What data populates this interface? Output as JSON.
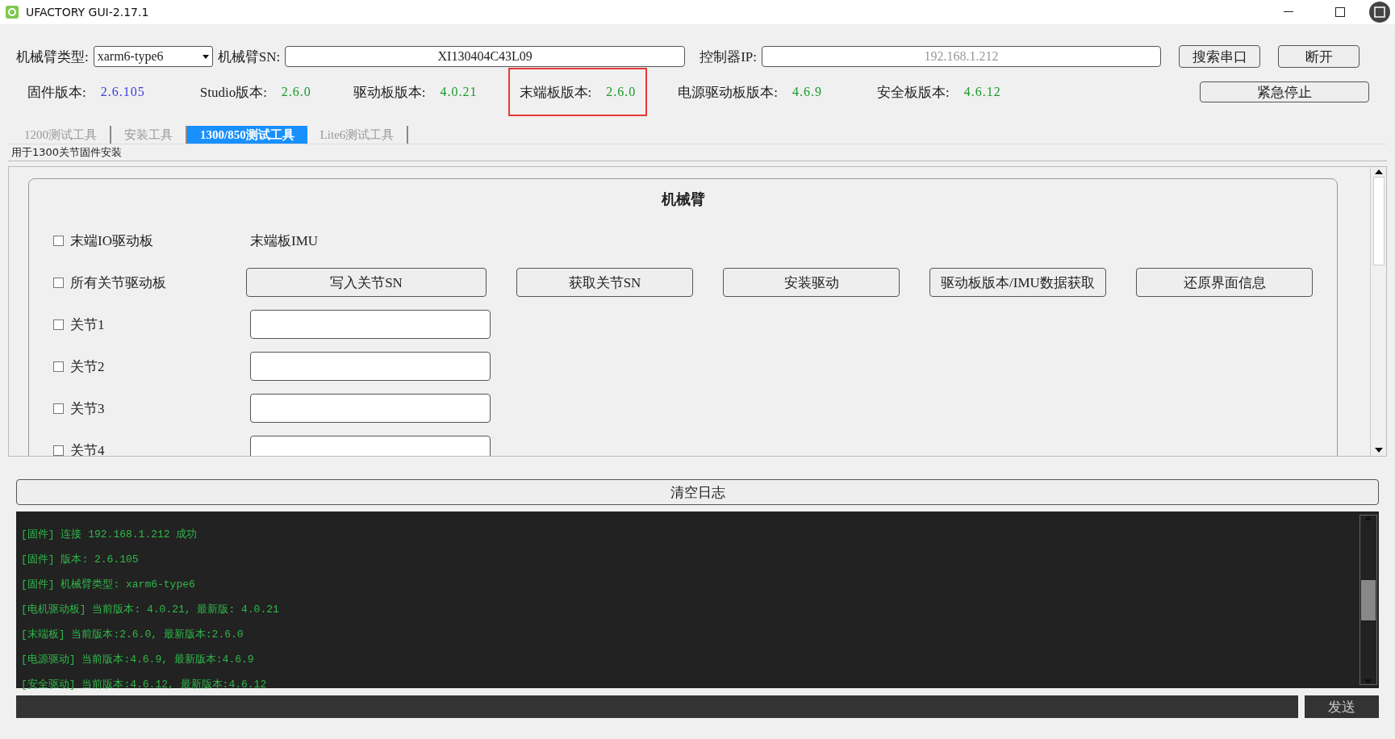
{
  "window": {
    "title": "UFACTORY GUI-2.17.1"
  },
  "connection": {
    "arm_type_label": "机械臂类型:",
    "arm_type": "xarm6-type6",
    "sn_label": "机械臂SN:",
    "sn": "XI130404C43L09",
    "ip_label": "控制器IP:",
    "ip": "192.168.1.212",
    "buttons": [
      "搜索串口",
      "断开"
    ]
  },
  "versions": [
    {
      "label": "固件版本:",
      "value": "2.6.105",
      "color": "#3a3ae0",
      "highlighted": false
    },
    {
      "label": "Studio版本:",
      "value": "2.6.0",
      "color": "#1a9a2a",
      "highlighted": false
    },
    {
      "label": "驱动板版本:",
      "value": "4.0.21",
      "color": "#1a9a2a",
      "highlighted": false
    },
    {
      "label": "末端板版本:",
      "value": "2.6.0",
      "color": "#1a9a2a",
      "highlighted": true
    },
    {
      "label": "电源驱动板版本:",
      "value": "4.6.9",
      "color": "#1a9a2a",
      "highlighted": false
    },
    {
      "label": "安全板版本:",
      "value": "4.6.12",
      "color": "#1a9a2a",
      "highlighted": false
    }
  ],
  "emergency_button": "紧急停止",
  "tabs": [
    {
      "label": "1200测试工具",
      "selected": false
    },
    {
      "label": "安装工具",
      "selected": false
    },
    {
      "label": "1300/850测试工具",
      "selected": true
    },
    {
      "label": "Lite6测试工具",
      "selected": false
    }
  ],
  "tab_description": "用于1300关节固件安装",
  "group": {
    "title": "机械臂",
    "rows": [
      {
        "kind": "label",
        "label": "末端IO驱动板",
        "checked": false,
        "text": "末端板IMU"
      },
      {
        "kind": "buttons",
        "label": "所有关节驱动板",
        "checked": false,
        "buttons": [
          "写入关节SN",
          "获取关节SN",
          "安装驱动",
          "驱动板版本/IMU数据获取",
          "还原界面信息"
        ]
      },
      {
        "kind": "field",
        "label": "关节1",
        "checked": false
      },
      {
        "kind": "field",
        "label": "关节2",
        "checked": false
      },
      {
        "kind": "field",
        "label": "关节3",
        "checked": false
      },
      {
        "kind": "field",
        "label": "关节4",
        "checked": false
      }
    ]
  },
  "log": {
    "clear_button": "清空日志",
    "lines": [
      "[固件] 连接 192.168.1.212 成功",
      "[固件] 版本: 2.6.105",
      "[固件] 机械臂类型: xarm6-type6",
      "[电机驱动板] 当前版本: 4.0.21, 最新版: 4.0.21",
      "[末端板] 当前版本:2.6.0, 最新版本:2.6.0",
      "[电源驱动] 当前版本:4.6.9, 最新版本:4.6.9",
      "[安全驱动] 当前版本:4.6.12, 最新版本:4.6.12"
    ]
  },
  "send_button": "发送"
}
